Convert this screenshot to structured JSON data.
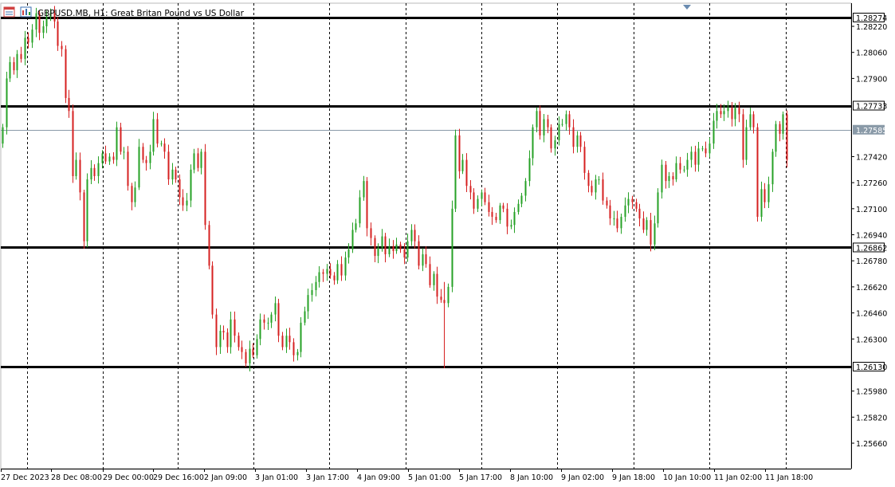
{
  "header": {
    "symbol": "GBPUSD.MB",
    "timeframe": "H1",
    "description": "Great Britan Pound vs US Dollar",
    "title_text": "GBPUSD.MB, H1:  Great Britan Pound vs US Dollar",
    "icons": [
      "chart-window-icon",
      "indicators-icon"
    ]
  },
  "colors": {
    "bull": "#26a126",
    "bear": "#d62020",
    "grid": "#000000",
    "level": "#000000",
    "current_price_line": "#8a9aa8",
    "current_price_badge": "#8a9aa8"
  },
  "chart_data": {
    "type": "candlestick",
    "symbol": "GBPUSD.MB",
    "timeframe": "H1",
    "y_range": [
      1.255,
      1.284
    ],
    "y_ticks": [
      "1.28274",
      "1.28220",
      "1.28060",
      "1.27900",
      "1.27733",
      "1.27585",
      "1.27420",
      "1.27260",
      "1.27100",
      "1.26940",
      "1.26862",
      "1.26780",
      "1.26620",
      "1.26460",
      "1.26300",
      "1.26130",
      "1.25980",
      "1.25820",
      "1.25660"
    ],
    "x_labels": [
      "27 Dec 2023",
      "28 Dec 08:00",
      "29 Dec 00:00",
      "29 Dec 16:00",
      "2 Jan 09:00",
      "3 Jan 01:00",
      "3 Jan 17:00",
      "4 Jan 09:00",
      "5 Jan 01:00",
      "5 Jan 17:00",
      "8 Jan 10:00",
      "9 Jan 02:00",
      "9 Jan 18:00",
      "10 Jan 10:00",
      "11 Jan 02:00",
      "11 Jan 18:00"
    ],
    "grid": "vertical dashed",
    "horizontal_levels": [
      "1.28274",
      "1.27733",
      "1.26862",
      "1.26130"
    ],
    "current_price": "1.27585",
    "closes": [
      1.276,
      1.279,
      1.28,
      1.2795,
      1.2805,
      1.2802,
      1.2815,
      1.2812,
      1.282,
      1.283,
      1.2818,
      1.2822,
      1.2828,
      1.283,
      1.2825,
      1.281,
      1.2808,
      1.2778,
      1.277,
      1.273,
      1.274,
      1.272,
      1.269,
      1.2728,
      1.2735,
      1.273,
      1.2738,
      1.2744,
      1.2739,
      1.2742,
      1.274,
      1.276,
      1.2745,
      1.2745,
      1.2724,
      1.2714,
      1.2723,
      1.2748,
      1.274,
      1.2738,
      1.2745,
      1.2765,
      1.275,
      1.275,
      1.2745,
      1.2728,
      1.2734,
      1.2728,
      1.2717,
      1.2712,
      1.2715,
      1.2734,
      1.2744,
      1.2735,
      1.2745,
      1.27,
      1.2675,
      1.2645,
      1.2625,
      1.2635,
      1.2634,
      1.2625,
      1.2642,
      1.2632,
      1.2625,
      1.2622,
      1.2615,
      1.2624,
      1.262,
      1.263,
      1.2642,
      1.264,
      1.264,
      1.2645,
      1.2652,
      1.2632,
      1.2625,
      1.2632,
      1.2628,
      1.262,
      1.2622,
      1.264,
      1.2647,
      1.2657,
      1.266,
      1.2665,
      1.2671,
      1.267,
      1.2673,
      1.2669,
      1.2666,
      1.2676,
      1.2669,
      1.268,
      1.2685,
      1.2697,
      1.2701,
      1.2717,
      1.2727,
      1.2698,
      1.2692,
      1.2681,
      1.2686,
      1.2693,
      1.2682,
      1.2687,
      1.2684,
      1.2688,
      1.2685,
      1.268,
      1.269,
      1.2697,
      1.269,
      1.2675,
      1.2682,
      1.2676,
      1.2663,
      1.267,
      1.2656,
      1.2654,
      1.2652,
      1.2662,
      1.271,
      1.2755,
      1.2733,
      1.274,
      1.2724,
      1.272,
      1.271,
      1.2716,
      1.272,
      1.2714,
      1.2708,
      1.2705,
      1.2703,
      1.2712,
      1.271,
      1.2699,
      1.27,
      1.2708,
      1.2713,
      1.2718,
      1.2727,
      1.2741,
      1.276,
      1.277,
      1.2755,
      1.2765,
      1.276,
      1.2747,
      1.2752,
      1.2762,
      1.2762,
      1.2768,
      1.276,
      1.2748,
      1.2755,
      1.2748,
      1.2732,
      1.2724,
      1.272,
      1.2728,
      1.2728,
      1.2715,
      1.2712,
      1.2704,
      1.2704,
      1.2698,
      1.2705,
      1.2712,
      1.2716,
      1.2714,
      1.271,
      1.2704,
      1.2697,
      1.2703,
      1.2688,
      1.2701,
      1.272,
      1.2737,
      1.2727,
      1.273,
      1.2728,
      1.2738,
      1.2734,
      1.2734,
      1.274,
      1.2745,
      1.2737,
      1.2747,
      1.2747,
      1.2744,
      1.275,
      1.2764,
      1.277,
      1.2768,
      1.277,
      1.2772,
      1.2765,
      1.2772,
      1.2768,
      1.274,
      1.276,
      1.2768,
      1.276,
      1.2705,
      1.2722,
      1.2714,
      1.2725,
      1.2745,
      1.2762,
      1.2756,
      1.2768,
      1.274
    ]
  }
}
